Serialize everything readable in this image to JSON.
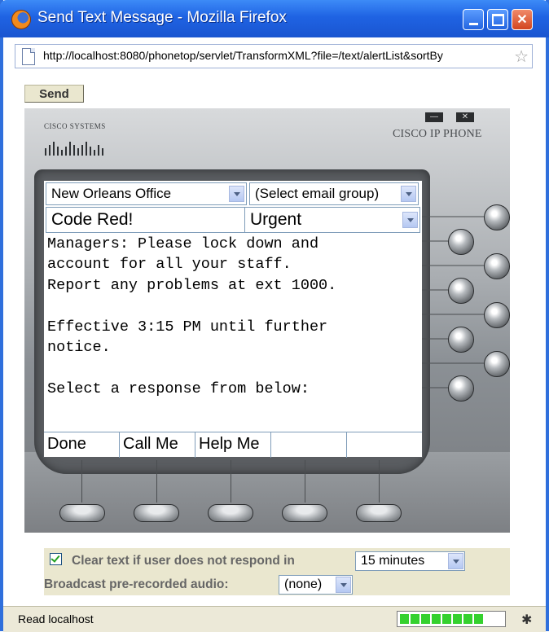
{
  "window": {
    "title": "Send Text Message - Mozilla Firefox"
  },
  "address_bar": {
    "url": "http://localhost:8080/phonetop/servlet/TransformXML?file=/text/alertList&sortBy"
  },
  "toolbar": {
    "send_label": "Send"
  },
  "phone": {
    "vendor_word": "CISCO SYSTEMS",
    "brand": "CISCO IP PHONE",
    "office_select": "New Orleans Office",
    "email_group_select": "(Select email group)",
    "subject": "Code Red!",
    "priority_select": "Urgent",
    "message": "Managers: Please lock down and\naccount for all your staff.\nReport any problems at ext 1000.\n\nEffective 3:15 PM until further\nnotice.\n\nSelect a response from below:",
    "softkeys": [
      "Done",
      "Call Me",
      "Help Me",
      "",
      ""
    ]
  },
  "options": {
    "clear_text_checked": true,
    "clear_text_label": "Clear text if user does not respond in",
    "clear_timeout_select": "15 minutes",
    "broadcast_label": "Broadcast pre-recorded audio:",
    "broadcast_select": "(none)"
  },
  "status_bar": {
    "text": "Read localhost",
    "progress_fraction": 0.75
  },
  "colors": {
    "titlebar": "#1f63e3",
    "panel": "#eae7cf",
    "progress": "#35d12e"
  }
}
